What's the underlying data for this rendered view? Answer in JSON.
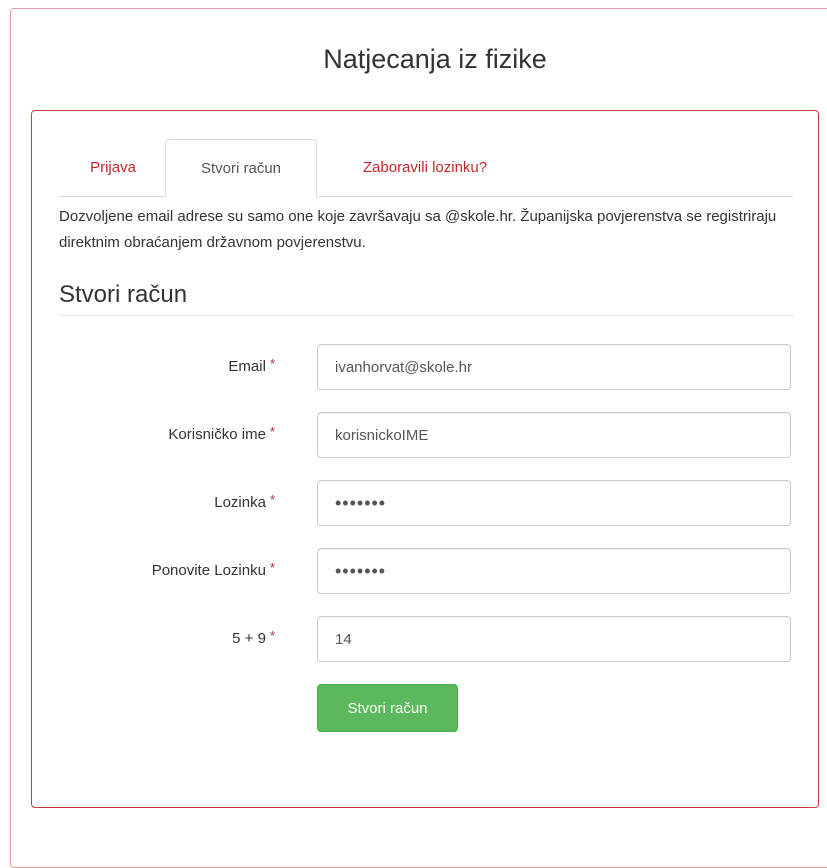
{
  "page": {
    "title": "Natjecanja iz fizike"
  },
  "tabs": [
    {
      "label": "Prijava",
      "active": false
    },
    {
      "label": "Stvori račun",
      "active": true
    },
    {
      "label": "Zaboravili lozinku?",
      "active": false
    }
  ],
  "intro_text": "Dozvoljene email adrese su samo one koje završavaju sa @skole.hr. Županijska povjerenstva se registriraju direktnim obraćanjem državnom povjerenstvu.",
  "form": {
    "section_title": "Stvori račun",
    "required_marker": "*",
    "fields": {
      "email": {
        "label": "Email",
        "value": "ivanhorvat@skole.hr"
      },
      "username": {
        "label": "Korisničko ime",
        "value": "korisnickoIME"
      },
      "password": {
        "label": "Lozinka",
        "value": "•••••••"
      },
      "password_repeat": {
        "label": "Ponovite Lozinku",
        "value": "•••••••"
      },
      "captcha": {
        "label": "5 + 9",
        "value": "14"
      }
    },
    "submit_label": "Stvori račun"
  },
  "colors": {
    "accent_red": "#c0292b",
    "panel_border": "#cc3a3a",
    "submit_green": "#5cb85c"
  }
}
